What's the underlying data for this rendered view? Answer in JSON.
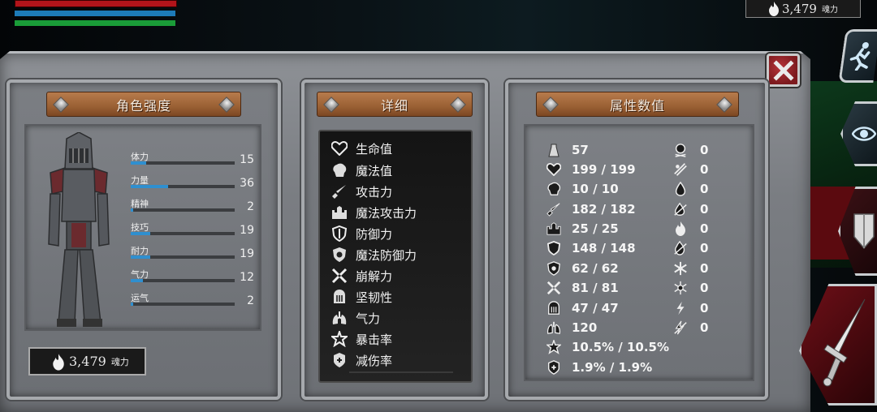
{
  "hud": {
    "soul_value": "3,479",
    "soul_unit": "魂力"
  },
  "panel_character": {
    "title": "角色强度",
    "stats": [
      {
        "name": "体力",
        "value": 15,
        "fill": 0.15
      },
      {
        "name": "力量",
        "value": 36,
        "fill": 0.36
      },
      {
        "name": "精神",
        "value": 2,
        "fill": 0.02
      },
      {
        "name": "技巧",
        "value": 19,
        "fill": 0.19
      },
      {
        "name": "耐力",
        "value": 19,
        "fill": 0.19
      },
      {
        "name": "气力",
        "value": 12,
        "fill": 0.12
      },
      {
        "name": "运气",
        "value": 2,
        "fill": 0.02
      }
    ],
    "soul_value": "3,479",
    "soul_unit": "魂力"
  },
  "panel_detail": {
    "title": "详细",
    "items": [
      {
        "label": "生命值",
        "icon": "heart-icon"
      },
      {
        "label": "魔法值",
        "icon": "brain-icon"
      },
      {
        "label": "攻击力",
        "icon": "sword-icon"
      },
      {
        "label": "魔法攻击力",
        "icon": "castle-icon"
      },
      {
        "label": "防御力",
        "icon": "shield-icon"
      },
      {
        "label": "魔法防御力",
        "icon": "magic-shield-icon"
      },
      {
        "label": "崩解力",
        "icon": "break-icon"
      },
      {
        "label": "坚韧性",
        "icon": "helmet-icon"
      },
      {
        "label": "气力",
        "icon": "lungs-icon"
      },
      {
        "label": "暴击率",
        "icon": "star-icon"
      },
      {
        "label": "减伤率",
        "icon": "damage-reduction-icon"
      }
    ]
  },
  "panel_attributes": {
    "title": "属性数值",
    "values": [
      {
        "icon": "weight-icon",
        "value": "57"
      },
      {
        "icon": "heart-icon",
        "value": "199 / 199"
      },
      {
        "icon": "brain-icon",
        "value": "10 / 10"
      },
      {
        "icon": "sword-icon",
        "value": "182 / 182"
      },
      {
        "icon": "castle-icon",
        "value": "25 / 25"
      },
      {
        "icon": "shield-icon",
        "value": "148 / 148"
      },
      {
        "icon": "magic-shield-icon",
        "value": "62 / 62"
      },
      {
        "icon": "break-icon",
        "value": "81 / 81"
      },
      {
        "icon": "helmet-icon",
        "value": "47 / 47"
      },
      {
        "icon": "lungs-icon",
        "value": "120"
      },
      {
        "icon": "star-icon",
        "value": "10.5% / 10.5%"
      },
      {
        "icon": "damage-reduction-icon",
        "value": "1.9% / 1.9%"
      }
    ],
    "resistances": [
      {
        "icon": "skull-icon",
        "value": "0"
      },
      {
        "icon": "bleed-icon",
        "value": "0"
      },
      {
        "icon": "drop-icon",
        "value": "0"
      },
      {
        "icon": "poison-icon",
        "value": "0"
      },
      {
        "icon": "fire-icon",
        "value": "0"
      },
      {
        "icon": "fire-resist-icon",
        "value": "0"
      },
      {
        "icon": "frost-icon",
        "value": "0"
      },
      {
        "icon": "frost-resist-icon",
        "value": "0"
      },
      {
        "icon": "lightning-icon",
        "value": "0"
      },
      {
        "icon": "lightning-resist-icon",
        "value": "0"
      }
    ]
  },
  "colors": {
    "health": "#b2141a",
    "mana": "#1d7bb8",
    "stamina": "#1a9c38",
    "stat_fill": "#2f8fcf",
    "plank": "#9a6034",
    "close": "#9b2328"
  }
}
